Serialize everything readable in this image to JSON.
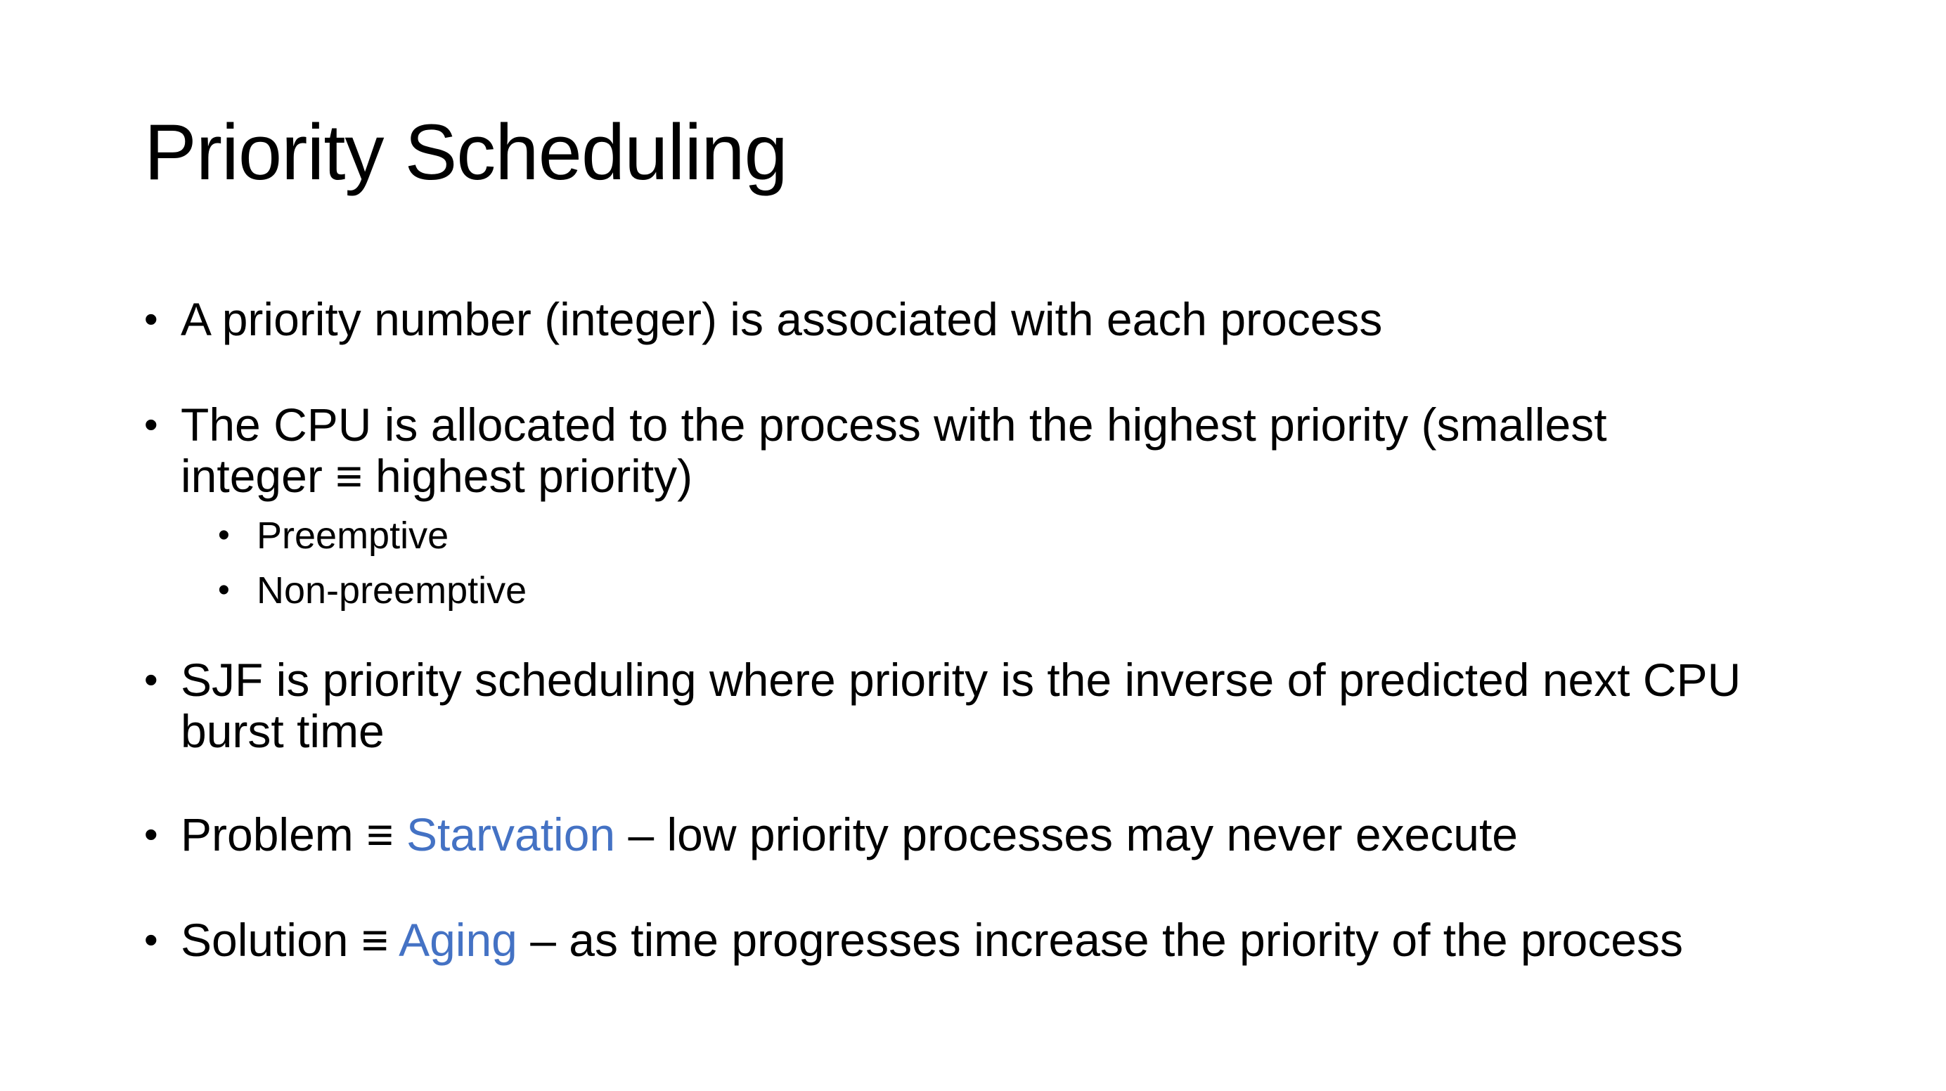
{
  "slide": {
    "title": "Priority Scheduling",
    "accent_color": "#4472c4",
    "bullets": {
      "b1": {
        "line1": "A priority number (integer) is associated with each process"
      },
      "b2": {
        "line1": "The CPU is allocated to the process with the highest priority (smallest",
        "line2": "integer ≡ highest priority)",
        "sub": [
          "Preemptive",
          "Non-preemptive"
        ]
      },
      "b3": {
        "line1": "SJF is priority scheduling where priority is the inverse of predicted next CPU",
        "line2": "burst time"
      },
      "b4": {
        "prefix": "Problem ≡ ",
        "term": "Starvation",
        "suffix": " – low priority processes may never execute"
      },
      "b5": {
        "prefix": "Solution ≡ ",
        "term": "Aging",
        "suffix": " – as time progresses increase the priority of the process"
      }
    },
    "bullet_glyph": "•"
  }
}
